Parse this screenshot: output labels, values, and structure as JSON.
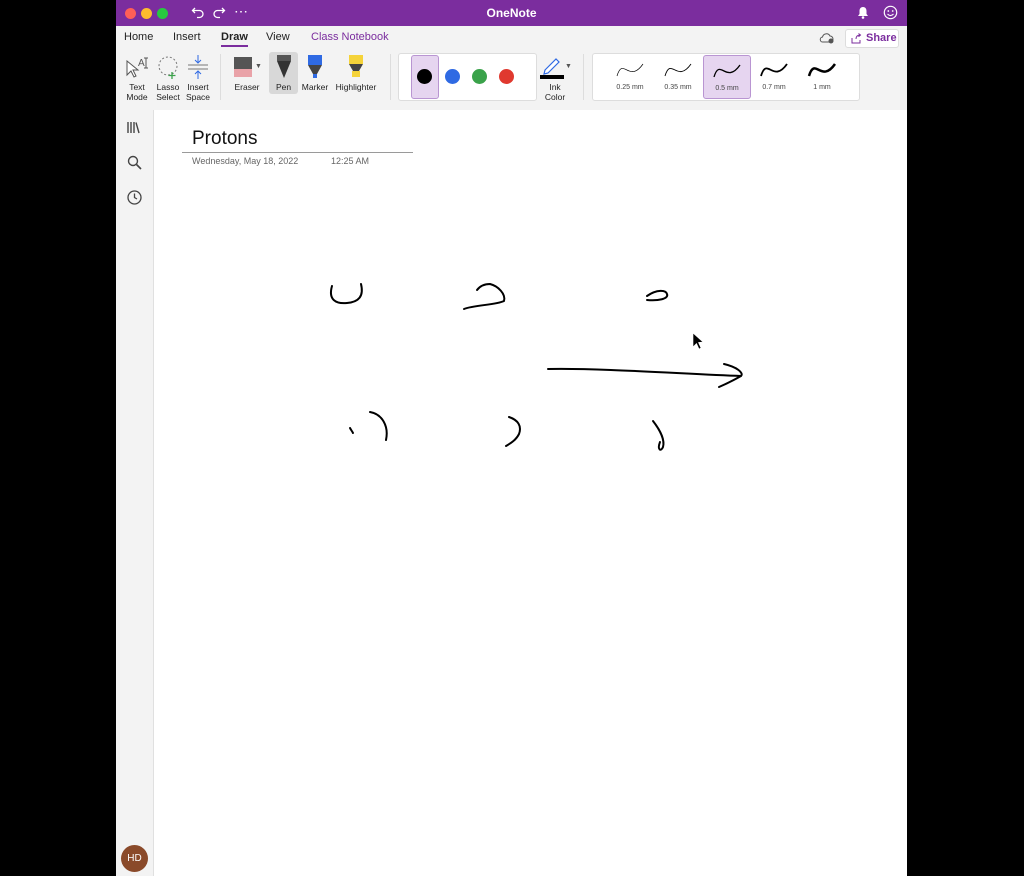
{
  "window": {
    "title": "OneNote"
  },
  "menu_tabs": {
    "home": "Home",
    "insert": "Insert",
    "draw": "Draw",
    "view": "View",
    "class_notebook": "Class Notebook"
  },
  "share_label": "Share",
  "ribbon": {
    "text_mode_1": "Text",
    "text_mode_2": "Mode",
    "lasso_1": "Lasso",
    "lasso_2": "Select",
    "insert_space_1": "Insert",
    "insert_space_2": "Space",
    "eraser": "Eraser",
    "pen": "Pen",
    "marker": "Marker",
    "highlighter": "Highlighter",
    "ink_color_1": "Ink",
    "ink_color_2": "Color",
    "colors": [
      "#000000",
      "#2f6ae3",
      "#3aa24a",
      "#e0392f"
    ],
    "selected_color": "#000000",
    "widths": [
      "0.25 mm",
      "0.35 mm",
      "0.5 mm",
      "0.7 mm",
      "1 mm"
    ],
    "selected_width": "0.5 mm"
  },
  "page": {
    "title": "Protons",
    "date": "Wednesday, May 18, 2022",
    "time": "12:25 AM"
  },
  "user": {
    "initials": "HD"
  },
  "theme": {
    "accent": "#7b2d9e"
  }
}
